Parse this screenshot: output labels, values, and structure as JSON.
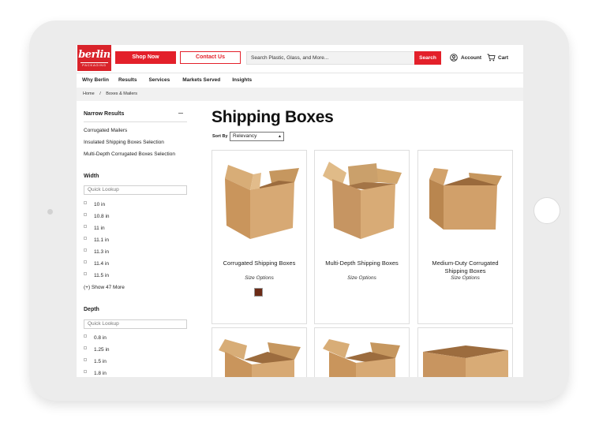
{
  "brand": {
    "name": "berlin",
    "sub": "PACKAGING"
  },
  "header": {
    "shop_now": "Shop Now",
    "contact_us": "Contact Us",
    "search_placeholder": "Search Plastic, Glass, and More...",
    "search_button": "Search",
    "account": "Account",
    "cart": "Cart"
  },
  "nav": [
    "Why Berlin",
    "Results",
    "Services",
    "Markets Served",
    "Insights"
  ],
  "breadcrumb": {
    "home": "Home",
    "sep": "/",
    "current": "Boxes & Mailers"
  },
  "sidebar": {
    "title": "Narrow Results",
    "links": [
      "Corrugated Mailers",
      "Insulated Shipping Boxes Selection",
      "Multi-Depth Corrugated Boxes Selection"
    ],
    "width": {
      "title": "Width",
      "lookup_placeholder": "Quick Lookup",
      "options": [
        "10 in",
        "10.8 in",
        "11 in",
        "11.1 in",
        "11.3 in",
        "11.4 in",
        "11.5 in"
      ],
      "show_more": "(+) Show 47 More"
    },
    "depth": {
      "title": "Depth",
      "lookup_placeholder": "Quick Lookup",
      "options": [
        "0.8 in",
        "1.25 in",
        "1.5 in",
        "1.8 in"
      ]
    }
  },
  "main": {
    "title": "Shipping Boxes",
    "sort_label": "Sort By",
    "sort_value": "Relevancy",
    "products": [
      {
        "name": "Corrugated Shipping Boxes",
        "options": "Size Options",
        "swatch_color": "#6b2b17"
      },
      {
        "name": "Multi-Depth Shipping Boxes",
        "options": "Size Options"
      },
      {
        "name": "Medium-Duty Corrugated Shipping Boxes",
        "options": "Size Options"
      }
    ]
  },
  "colors": {
    "accent": "#e3202a",
    "box": "#c89a63"
  }
}
